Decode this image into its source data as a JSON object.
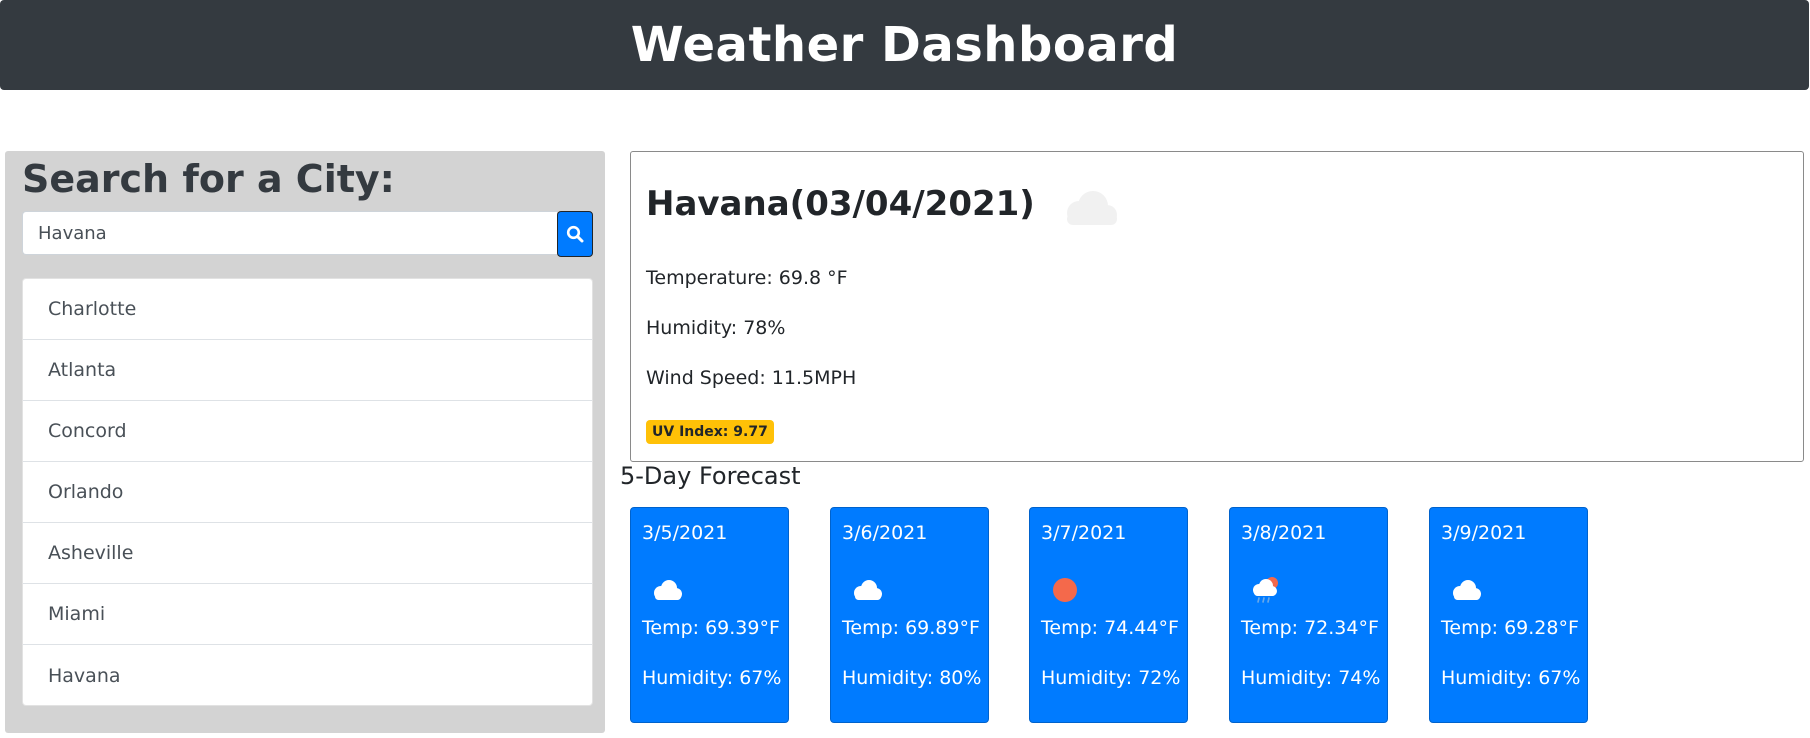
{
  "header": {
    "title": "Weather Dashboard"
  },
  "search": {
    "heading": "Search for a City:",
    "value": "Havana",
    "button_icon": "search-icon"
  },
  "history": [
    {
      "label": "Charlotte"
    },
    {
      "label": "Atlanta"
    },
    {
      "label": "Concord"
    },
    {
      "label": "Orlando"
    },
    {
      "label": "Asheville"
    },
    {
      "label": "Miami"
    },
    {
      "label": "Havana"
    }
  ],
  "current": {
    "title": "Havana(03/04/2021)",
    "icon": "cloud-icon",
    "temperature": "Temperature: 69.8 °F",
    "humidity": "Humidity: 78%",
    "wind": "Wind Speed: 11.5MPH",
    "uv": "UV Index: 9.77"
  },
  "forecast": {
    "title": "5-Day Forecast",
    "days": [
      {
        "date": "3/5/2021",
        "icon": "cloud-icon",
        "temp": "Temp: 69.39°F",
        "humidity": "Humidity: 67%"
      },
      {
        "date": "3/6/2021",
        "icon": "cloud-icon",
        "temp": "Temp: 69.89°F",
        "humidity": "Humidity: 80%"
      },
      {
        "date": "3/7/2021",
        "icon": "sun-icon",
        "temp": "Temp: 74.44°F",
        "humidity": "Humidity: 72%"
      },
      {
        "date": "3/8/2021",
        "icon": "rain-icon",
        "temp": "Temp: 72.34°F",
        "humidity": "Humidity: 74%"
      },
      {
        "date": "3/9/2021",
        "icon": "cloud-icon",
        "temp": "Temp: 69.28°F",
        "humidity": "Humidity: 67%"
      }
    ]
  },
  "colors": {
    "header_bg": "#343a40",
    "sidebar_bg": "#d3d3d3",
    "accent": "#007bff",
    "uv_badge": "#ffc107",
    "sun": "#f4694b"
  }
}
